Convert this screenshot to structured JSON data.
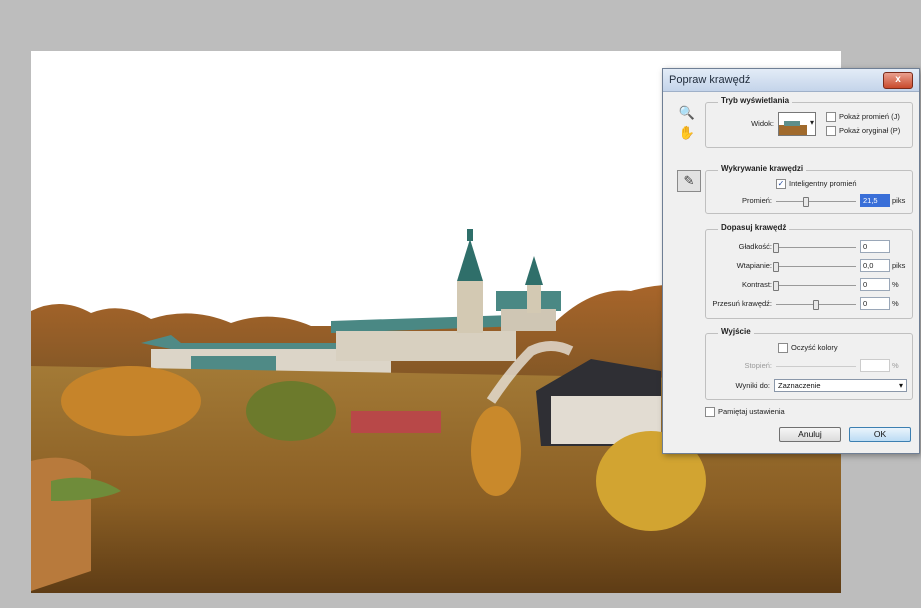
{
  "dialog": {
    "title": "Popraw krawędź",
    "close_glyph": "x",
    "tools": {
      "zoom_glyph": "🔍",
      "hand_glyph": "✋",
      "refine_glyph": "✎"
    },
    "view_mode": {
      "legend": "Tryb wyświetlania",
      "view_label": "Widok:",
      "dropdown_glyph": "▾",
      "show_radius_label": "Pokaż promień (J)",
      "show_original_label": "Pokaż oryginał (P)"
    },
    "edge_detection": {
      "legend": "Wykrywanie krawędzi",
      "smart_radius_label": "Inteligentny promień",
      "smart_radius_checked": true,
      "radius_label": "Promień:",
      "radius_value": "21,5",
      "radius_unit": "piks",
      "radius_slider": 0.38
    },
    "adjust_edge": {
      "legend": "Dopasuj krawędź",
      "smooth_label": "Gładkość:",
      "smooth_value": "0",
      "smooth_slider": 0,
      "feather_label": "Wtapianie:",
      "feather_value": "0,0",
      "feather_unit": "piks",
      "feather_slider": 0,
      "contrast_label": "Kontrast:",
      "contrast_value": "0",
      "contrast_unit": "%",
      "contrast_slider": 0,
      "shift_label": "Przesuń krawędź:",
      "shift_value": "0",
      "shift_unit": "%",
      "shift_slider": 0.5
    },
    "output": {
      "legend": "Wyjście",
      "decontaminate_label": "Oczyść kolory",
      "amount_label": "Stopień:",
      "amount_unit": "%",
      "output_to_label": "Wyniki do:",
      "output_to_value": "Zaznaczenie",
      "dropdown_glyph": "▾"
    },
    "remember_label": "Pamiętaj ustawienia",
    "cancel_label": "Anuluj",
    "ok_label": "OK",
    "check_glyph": "✓"
  },
  "colors": {
    "workspace": "#bdbdbd",
    "dialog_title_top": "#e3ecf7",
    "close_button": "#c94a2c",
    "selection_highlight": "#3a6fd8"
  }
}
